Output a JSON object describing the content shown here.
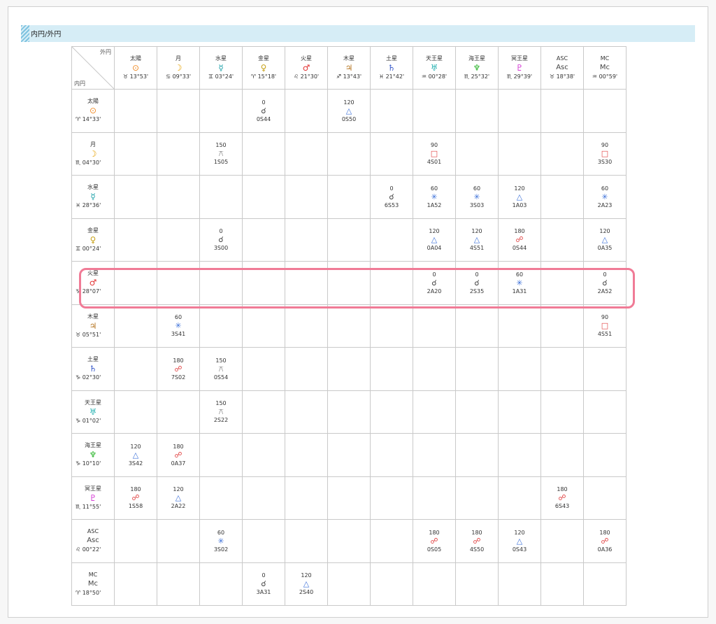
{
  "section": {
    "title": "内円/外円"
  },
  "corner": {
    "outer_label": "外円",
    "inner_label": "内円"
  },
  "columns": [
    {
      "name": "太陽",
      "symbol": "⊙",
      "color": "#f08a24",
      "position": "♉ 13°53'"
    },
    {
      "name": "月",
      "symbol": "☽",
      "color": "#e6a100",
      "position": "♋ 09°33'"
    },
    {
      "name": "水星",
      "symbol": "☿",
      "color": "#1aa0a8",
      "position": "♊ 03°24'"
    },
    {
      "name": "金星",
      "symbol": "♀",
      "color": "#c8a21a",
      "position": "♈ 15°18'"
    },
    {
      "name": "火星",
      "symbol": "♂",
      "color": "#e23030",
      "position": "♌ 21°30'"
    },
    {
      "name": "木星",
      "symbol": "♃",
      "color": "#b5741f",
      "position": "♐ 13°43'"
    },
    {
      "name": "土星",
      "symbol": "♄",
      "color": "#3557c9",
      "position": "♓ 21°42'"
    },
    {
      "name": "天王星",
      "symbol": "♅",
      "color": "#2ab3b3",
      "position": "♒ 00°28'"
    },
    {
      "name": "海王星",
      "symbol": "♆",
      "color": "#2cb52c",
      "position": "♏ 25°32'"
    },
    {
      "name": "冥王星",
      "symbol": "♇",
      "color": "#d22ad2",
      "position": "♏ 29°39'"
    },
    {
      "name": "ASC",
      "symbol": "Asc",
      "color": "#444444",
      "position": "♉ 18°38'"
    },
    {
      "name": "MC",
      "symbol": "Mc",
      "color": "#444444",
      "position": "♒ 00°59'"
    }
  ],
  "rows": [
    {
      "name": "太陽",
      "symbol": "⊙",
      "color": "#f08a24",
      "position": "♈ 14°33'",
      "cells": [
        null,
        null,
        null,
        {
          "angle": "0",
          "symbol": "☌",
          "orb": "0S44"
        },
        null,
        {
          "angle": "120",
          "symbol": "△",
          "orb": "0S50"
        },
        null,
        null,
        null,
        null,
        null,
        null
      ]
    },
    {
      "name": "月",
      "symbol": "☽",
      "color": "#e6a100",
      "position": "♏ 04°30'",
      "cells": [
        null,
        null,
        {
          "angle": "150",
          "symbol": "⚻",
          "orb": "1S05"
        },
        null,
        null,
        null,
        null,
        {
          "angle": "90",
          "symbol": "□",
          "orb": "4S01"
        },
        null,
        null,
        null,
        {
          "angle": "90",
          "symbol": "□",
          "orb": "3S30"
        }
      ]
    },
    {
      "name": "水星",
      "symbol": "☿",
      "color": "#1aa0a8",
      "position": "♓ 28°36'",
      "cells": [
        null,
        null,
        null,
        null,
        null,
        null,
        {
          "angle": "0",
          "symbol": "☌",
          "orb": "6S53"
        },
        {
          "angle": "60",
          "symbol": "✳",
          "orb": "1A52"
        },
        {
          "angle": "60",
          "symbol": "✳",
          "orb": "3S03"
        },
        {
          "angle": "120",
          "symbol": "△",
          "orb": "1A03"
        },
        null,
        {
          "angle": "60",
          "symbol": "✳",
          "orb": "2A23"
        }
      ]
    },
    {
      "name": "金星",
      "symbol": "♀",
      "color": "#c8a21a",
      "position": "♊ 00°24'",
      "cells": [
        null,
        null,
        {
          "angle": "0",
          "symbol": "☌",
          "orb": "3S00"
        },
        null,
        null,
        null,
        null,
        {
          "angle": "120",
          "symbol": "△",
          "orb": "0A04"
        },
        {
          "angle": "120",
          "symbol": "△",
          "orb": "4S51"
        },
        {
          "angle": "180",
          "symbol": "☍",
          "orb": "0S44"
        },
        null,
        {
          "angle": "120",
          "symbol": "△",
          "orb": "0A35"
        }
      ]
    },
    {
      "name": "火星",
      "symbol": "♂",
      "color": "#e23030",
      "position": "♑ 28°07'",
      "cells": [
        null,
        null,
        null,
        null,
        null,
        null,
        null,
        {
          "angle": "0",
          "symbol": "☌",
          "orb": "2A20"
        },
        {
          "angle": "0",
          "symbol": "☌",
          "orb": "2S35"
        },
        {
          "angle": "60",
          "symbol": "✳",
          "orb": "1A31"
        },
        null,
        {
          "angle": "0",
          "symbol": "☌",
          "orb": "2A52"
        }
      ]
    },
    {
      "name": "木星",
      "symbol": "♃",
      "color": "#b5741f",
      "position": "♉ 05°51'",
      "cells": [
        null,
        {
          "angle": "60",
          "symbol": "✳",
          "orb": "3S41"
        },
        null,
        null,
        null,
        null,
        null,
        null,
        null,
        null,
        null,
        {
          "angle": "90",
          "symbol": "□",
          "orb": "4S51"
        }
      ]
    },
    {
      "name": "土星",
      "symbol": "♄",
      "color": "#3557c9",
      "position": "♑ 02°30'",
      "cells": [
        null,
        {
          "angle": "180",
          "symbol": "☍",
          "orb": "7S02"
        },
        {
          "angle": "150",
          "symbol": "⚻",
          "orb": "0S54"
        },
        null,
        null,
        null,
        null,
        null,
        null,
        null,
        null,
        null
      ]
    },
    {
      "name": "天王星",
      "symbol": "♅",
      "color": "#2ab3b3",
      "position": "♑ 01°02'",
      "cells": [
        null,
        null,
        {
          "angle": "150",
          "symbol": "⚻",
          "orb": "2S22"
        },
        null,
        null,
        null,
        null,
        null,
        null,
        null,
        null,
        null
      ]
    },
    {
      "name": "海王星",
      "symbol": "♆",
      "color": "#2cb52c",
      "position": "♑ 10°10'",
      "cells": [
        {
          "angle": "120",
          "symbol": "△",
          "orb": "3S42"
        },
        {
          "angle": "180",
          "symbol": "☍",
          "orb": "0A37"
        },
        null,
        null,
        null,
        null,
        null,
        null,
        null,
        null,
        null,
        null
      ]
    },
    {
      "name": "冥王星",
      "symbol": "♇",
      "color": "#d22ad2",
      "position": "♏ 11°55'",
      "cells": [
        {
          "angle": "180",
          "symbol": "☍",
          "orb": "1S58"
        },
        {
          "angle": "120",
          "symbol": "△",
          "orb": "2A22"
        },
        null,
        null,
        null,
        null,
        null,
        null,
        null,
        null,
        {
          "angle": "180",
          "symbol": "☍",
          "orb": "6S43"
        },
        null
      ]
    },
    {
      "name": "ASC",
      "symbol": "Asc",
      "color": "#444444",
      "position": "♌ 00°22'",
      "cells": [
        null,
        null,
        {
          "angle": "60",
          "symbol": "✳",
          "orb": "3S02"
        },
        null,
        null,
        null,
        null,
        {
          "angle": "180",
          "symbol": "☍",
          "orb": "0S05"
        },
        {
          "angle": "180",
          "symbol": "☍",
          "orb": "4S50"
        },
        {
          "angle": "120",
          "symbol": "△",
          "orb": "0S43"
        },
        null,
        {
          "angle": "180",
          "symbol": "☍",
          "orb": "0A36"
        }
      ]
    },
    {
      "name": "MC",
      "symbol": "Mc",
      "color": "#444444",
      "position": "♈ 18°50'",
      "cells": [
        null,
        null,
        null,
        {
          "angle": "0",
          "symbol": "☌",
          "orb": "3A31"
        },
        {
          "angle": "120",
          "symbol": "△",
          "orb": "2S40"
        },
        null,
        null,
        null,
        null,
        null,
        null,
        null
      ]
    }
  ],
  "aspect_colors": {
    "☌": "#444444",
    "△": "#3a6fd8",
    "✳": "#3a6fd8",
    "□": "#e04040",
    "☍": "#e04040",
    "⚻": "#888888"
  },
  "highlight_row": "火星",
  "highlight_color": "#f07b96"
}
